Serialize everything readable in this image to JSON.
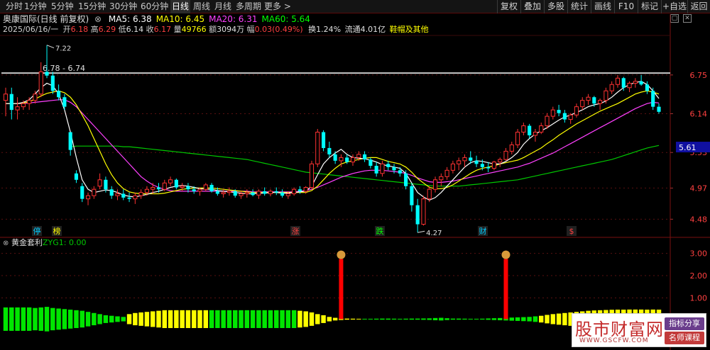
{
  "toolbar": {
    "periods": [
      "分时",
      "1分钟",
      "5分钟",
      "15分钟",
      "30分钟",
      "60分钟",
      "日线",
      "周线",
      "月线",
      "多周期",
      "更多 >"
    ],
    "active": "日线",
    "right": [
      "复权",
      "叠加",
      "多股",
      "统计",
      "画线",
      "F10",
      "标记",
      "+自选",
      "返回"
    ]
  },
  "header": {
    "title": "奥康国际(日线 前复权)",
    "ma": [
      {
        "label": "MA5: 6.38",
        "color": "#ffffff"
      },
      {
        "label": "MA10: 6.45",
        "color": "#ffff00"
      },
      {
        "label": "MA20: 6.31",
        "color": "#ff40ff"
      },
      {
        "label": "MA60: 5.64",
        "color": "#00ff00"
      }
    ],
    "date": "2025/06/16/一",
    "open_label": "开",
    "open": "6.18",
    "high_label": "高",
    "high": "6.29",
    "low_label": "低",
    "low": "6.14",
    "close_label": "收",
    "close": "6.17",
    "vol_label": "量",
    "vol": "49766",
    "amt_label": "额",
    "amt": "3094万",
    "chg_label": "幅",
    "chg": "0.03(0.49%)",
    "turnover": "换1.24%",
    "float": "流通4.01亿",
    "industry": "鞋帽及其他"
  },
  "indicator": {
    "title": "黄金套利",
    "value": "ZYG1: 0.00",
    "y_ticks": [
      "3.00",
      "2.00",
      "1.00"
    ]
  },
  "annotations": {
    "hline": "6.78 - 6.74",
    "high_mark": "7.22",
    "low_mark": "4.27",
    "price_tag": "5.61",
    "events": [
      "停",
      "榜",
      "涨",
      "跌",
      "财",
      "$"
    ]
  },
  "watermark": {
    "name": "股市财富网",
    "url": "WWW.GSCFW.COM",
    "tag1": "指标分享",
    "tag2": "名师课程"
  },
  "colors": {
    "up": "#ff3232",
    "down": "#00ffff",
    "ma5": "#ffffff",
    "ma10": "#ffff00",
    "ma20": "#ff40ff",
    "ma60": "#00c800",
    "bar_green": "#00e600",
    "bar_yellow": "#ffff00",
    "signal": "#ff0000"
  },
  "chart_data": {
    "type": "candlestick",
    "y_ticks": [
      6.75,
      6.14,
      5.53,
      4.97,
      4.48
    ],
    "ylim": [
      4.25,
      7.35
    ],
    "candles": [
      [
        6.35,
        6.55,
        6.1,
        6.45
      ],
      [
        6.45,
        6.55,
        6.05,
        6.2
      ],
      [
        6.2,
        6.4,
        6.05,
        6.25
      ],
      [
        6.25,
        6.35,
        6.2,
        6.3
      ],
      [
        6.3,
        6.4,
        6.2,
        6.35
      ],
      [
        6.35,
        6.5,
        6.3,
        6.45
      ],
      [
        6.45,
        6.95,
        6.4,
        6.8
      ],
      [
        6.8,
        7.22,
        6.7,
        6.74
      ],
      [
        6.74,
        6.8,
        6.45,
        6.5
      ],
      [
        6.5,
        6.6,
        6.35,
        6.4
      ],
      [
        6.4,
        6.45,
        6.2,
        6.25
      ],
      [
        5.85,
        5.6,
        5.48,
        5.57
      ],
      [
        5.2,
        5.25,
        5.05,
        5.1
      ],
      [
        5.0,
        5.05,
        4.75,
        4.8
      ],
      [
        4.8,
        4.9,
        4.7,
        4.85
      ],
      [
        4.85,
        5.0,
        4.8,
        4.95
      ],
      [
        5.0,
        5.2,
        4.95,
        5.1
      ],
      [
        5.1,
        5.15,
        4.9,
        4.95
      ],
      [
        4.95,
        5.0,
        4.8,
        4.85
      ],
      [
        4.85,
        4.95,
        4.78,
        4.88
      ],
      [
        4.88,
        4.95,
        4.78,
        4.82
      ],
      [
        4.82,
        4.9,
        4.75,
        4.8
      ],
      [
        4.8,
        4.9,
        4.72,
        4.85
      ],
      [
        4.85,
        4.95,
        4.8,
        4.9
      ],
      [
        4.9,
        5.0,
        4.85,
        4.95
      ],
      [
        4.95,
        5.05,
        4.88,
        4.98
      ],
      [
        4.98,
        5.05,
        4.9,
        4.95
      ],
      [
        4.95,
        5.1,
        4.92,
        5.05
      ],
      [
        5.05,
        5.15,
        5.0,
        5.1
      ],
      [
        5.1,
        5.12,
        4.95,
        4.98
      ],
      [
        4.98,
        5.05,
        4.92,
        5.0
      ],
      [
        5.0,
        5.05,
        4.9,
        4.95
      ],
      [
        4.95,
        5.0,
        4.88,
        4.92
      ],
      [
        4.92,
        4.98,
        4.85,
        4.95
      ],
      [
        4.95,
        5.05,
        4.92,
        5.02
      ],
      [
        5.02,
        5.05,
        4.9,
        4.92
      ],
      [
        4.92,
        4.98,
        4.85,
        4.88
      ],
      [
        4.88,
        4.95,
        4.82,
        4.9
      ],
      [
        4.9,
        4.98,
        4.85,
        4.92
      ],
      [
        4.92,
        4.95,
        4.82,
        4.85
      ],
      [
        4.85,
        4.92,
        4.8,
        4.88
      ],
      [
        4.88,
        4.95,
        4.82,
        4.9
      ],
      [
        4.9,
        4.95,
        4.84,
        4.86
      ],
      [
        4.86,
        4.95,
        4.8,
        4.92
      ],
      [
        4.92,
        4.98,
        4.85,
        4.88
      ],
      [
        4.88,
        4.95,
        4.84,
        4.92
      ],
      [
        4.92,
        4.98,
        4.86,
        4.9
      ],
      [
        4.9,
        4.95,
        4.82,
        4.85
      ],
      [
        4.85,
        4.92,
        4.8,
        4.88
      ],
      [
        4.88,
        4.98,
        4.85,
        4.95
      ],
      [
        4.95,
        5.0,
        4.88,
        4.92
      ],
      [
        4.92,
        5.0,
        4.88,
        4.98
      ],
      [
        4.98,
        5.4,
        4.95,
        5.35
      ],
      [
        5.35,
        5.9,
        5.3,
        5.85
      ],
      [
        5.85,
        5.88,
        5.55,
        5.6
      ],
      [
        5.6,
        5.7,
        5.45,
        5.5
      ],
      [
        5.5,
        5.55,
        5.35,
        5.4
      ],
      [
        5.4,
        5.5,
        5.3,
        5.45
      ],
      [
        5.45,
        5.5,
        5.35,
        5.38
      ],
      [
        5.38,
        5.5,
        5.32,
        5.45
      ],
      [
        5.45,
        5.55,
        5.4,
        5.5
      ],
      [
        5.5,
        5.55,
        5.38,
        5.42
      ],
      [
        5.42,
        5.45,
        5.28,
        5.32
      ],
      [
        5.32,
        5.38,
        5.15,
        5.2
      ],
      [
        5.2,
        5.4,
        5.15,
        5.35
      ],
      [
        5.35,
        5.4,
        5.25,
        5.3
      ],
      [
        5.3,
        5.35,
        5.2,
        5.25
      ],
      [
        5.25,
        5.3,
        5.15,
        5.2
      ],
      [
        5.2,
        5.25,
        4.95,
        5.0
      ],
      [
        5.0,
        5.05,
        4.6,
        4.7
      ],
      [
        4.7,
        4.8,
        4.27,
        4.4
      ],
      [
        4.4,
        4.85,
        4.38,
        4.8
      ],
      [
        4.8,
        5.0,
        4.75,
        4.95
      ],
      [
        4.95,
        5.15,
        4.9,
        5.1
      ],
      [
        5.1,
        5.2,
        5.0,
        5.15
      ],
      [
        5.15,
        5.3,
        5.1,
        5.25
      ],
      [
        5.25,
        5.4,
        5.2,
        5.35
      ],
      [
        5.35,
        5.45,
        5.25,
        5.4
      ],
      [
        5.4,
        5.5,
        5.3,
        5.45
      ],
      [
        5.45,
        5.55,
        5.35,
        5.4
      ],
      [
        5.4,
        5.48,
        5.3,
        5.35
      ],
      [
        5.35,
        5.42,
        5.25,
        5.3
      ],
      [
        5.3,
        5.38,
        5.22,
        5.28
      ],
      [
        5.28,
        5.4,
        5.25,
        5.38
      ],
      [
        5.38,
        5.45,
        5.3,
        5.42
      ],
      [
        5.42,
        5.6,
        5.4,
        5.55
      ],
      [
        5.55,
        5.7,
        5.5,
        5.65
      ],
      [
        5.65,
        5.9,
        5.6,
        5.85
      ],
      [
        5.85,
        6.0,
        5.8,
        5.95
      ],
      [
        5.95,
        5.98,
        5.75,
        5.8
      ],
      [
        5.8,
        5.9,
        5.7,
        5.85
      ],
      [
        5.85,
        6.0,
        5.82,
        5.95
      ],
      [
        5.95,
        6.15,
        5.9,
        6.1
      ],
      [
        6.1,
        6.25,
        6.05,
        6.2
      ],
      [
        6.2,
        6.28,
        6.1,
        6.15
      ],
      [
        6.15,
        6.2,
        6.0,
        6.05
      ],
      [
        6.05,
        6.15,
        5.98,
        6.12
      ],
      [
        6.12,
        6.3,
        6.08,
        6.25
      ],
      [
        6.25,
        6.4,
        6.2,
        6.35
      ],
      [
        6.35,
        6.45,
        6.28,
        6.4
      ],
      [
        6.4,
        6.42,
        6.25,
        6.3
      ],
      [
        6.3,
        6.38,
        6.2,
        6.35
      ],
      [
        6.35,
        6.55,
        6.3,
        6.5
      ],
      [
        6.5,
        6.65,
        6.45,
        6.6
      ],
      [
        6.6,
        6.75,
        6.55,
        6.7
      ],
      [
        6.7,
        6.72,
        6.5,
        6.55
      ],
      [
        6.55,
        6.65,
        6.48,
        6.62
      ],
      [
        6.62,
        6.7,
        6.55,
        6.65
      ],
      [
        6.65,
        6.75,
        6.58,
        6.6
      ],
      [
        6.6,
        6.65,
        6.45,
        6.5
      ],
      [
        6.5,
        6.55,
        6.2,
        6.25
      ],
      [
        6.25,
        6.3,
        6.14,
        6.17
      ]
    ],
    "ma5": [
      6.3,
      6.3,
      6.3,
      6.32,
      6.36,
      6.45,
      6.55,
      6.62,
      6.58,
      6.45,
      6.2,
      5.85,
      5.45,
      5.1,
      4.95,
      4.9,
      4.92,
      4.94,
      4.93,
      4.9,
      4.86,
      4.84,
      4.83,
      4.85,
      4.87,
      4.9,
      4.92,
      4.95,
      4.98,
      5.0,
      5.01,
      5.0,
      4.98,
      4.96,
      4.95,
      4.95,
      4.93,
      4.92,
      4.91,
      4.9,
      4.89,
      4.88,
      4.88,
      4.89,
      4.89,
      4.9,
      4.9,
      4.89,
      4.89,
      4.9,
      4.91,
      4.92,
      5.0,
      5.18,
      5.35,
      5.45,
      5.52,
      5.58,
      5.5,
      5.45,
      5.44,
      5.43,
      5.41,
      5.38,
      5.34,
      5.32,
      5.3,
      5.28,
      5.2,
      5.05,
      4.9,
      4.83,
      4.78,
      4.82,
      4.9,
      5.0,
      5.1,
      5.2,
      5.3,
      5.37,
      5.4,
      5.39,
      5.37,
      5.35,
      5.35,
      5.39,
      5.45,
      5.53,
      5.66,
      5.75,
      5.82,
      5.87,
      5.92,
      5.98,
      6.04,
      6.09,
      6.12,
      6.16,
      6.2,
      6.25,
      6.28,
      6.3,
      6.34,
      6.4,
      6.48,
      6.55,
      6.6,
      6.63,
      6.65,
      6.6,
      6.5,
      6.38
    ],
    "ma10": [
      6.3,
      6.3,
      6.3,
      6.31,
      6.33,
      6.37,
      6.42,
      6.46,
      6.48,
      6.5,
      6.47,
      6.4,
      6.28,
      6.12,
      5.95,
      5.75,
      5.55,
      5.35,
      5.18,
      5.05,
      4.96,
      4.91,
      4.89,
      4.88,
      4.88,
      4.88,
      4.88,
      4.89,
      4.91,
      4.93,
      4.95,
      4.96,
      4.97,
      4.97,
      4.97,
      4.97,
      4.96,
      4.95,
      4.94,
      4.93,
      4.92,
      4.91,
      4.9,
      4.9,
      4.9,
      4.9,
      4.9,
      4.9,
      4.9,
      4.9,
      4.9,
      4.9,
      4.93,
      5.0,
      5.1,
      5.2,
      5.28,
      5.35,
      5.38,
      5.4,
      5.42,
      5.44,
      5.45,
      5.45,
      5.42,
      5.39,
      5.37,
      5.35,
      5.3,
      5.22,
      5.12,
      5.05,
      4.98,
      4.96,
      4.96,
      4.98,
      5.02,
      5.08,
      5.14,
      5.2,
      5.25,
      5.28,
      5.3,
      5.32,
      5.35,
      5.37,
      5.39,
      5.41,
      5.45,
      5.5,
      5.55,
      5.6,
      5.67,
      5.73,
      5.8,
      5.86,
      5.92,
      5.98,
      6.03,
      6.08,
      6.13,
      6.18,
      6.22,
      6.26,
      6.3,
      6.35,
      6.4,
      6.45,
      6.48,
      6.5,
      6.48,
      6.45
    ],
    "ma20": [
      6.3,
      6.3,
      6.3,
      6.3,
      6.31,
      6.32,
      6.33,
      6.34,
      6.35,
      6.36,
      6.36,
      6.32,
      6.25,
      6.15,
      6.05,
      5.95,
      5.85,
      5.75,
      5.65,
      5.55,
      5.45,
      5.35,
      5.25,
      5.15,
      5.08,
      5.02,
      4.98,
      4.95,
      4.93,
      4.92,
      4.92,
      4.92,
      4.92,
      4.92,
      4.92,
      4.92,
      4.92,
      4.92,
      4.92,
      4.92,
      4.92,
      4.92,
      4.91,
      4.91,
      4.91,
      4.91,
      4.91,
      4.91,
      4.91,
      4.91,
      4.92,
      4.93,
      4.95,
      4.98,
      5.02,
      5.06,
      5.1,
      5.14,
      5.17,
      5.2,
      5.22,
      5.24,
      5.25,
      5.25,
      5.25,
      5.24,
      5.23,
      5.22,
      5.2,
      5.17,
      5.13,
      5.1,
      5.07,
      5.06,
      5.06,
      5.07,
      5.08,
      5.1,
      5.12,
      5.14,
      5.16,
      5.18,
      5.2,
      5.22,
      5.24,
      5.26,
      5.28,
      5.3,
      5.33,
      5.36,
      5.4,
      5.44,
      5.48,
      5.52,
      5.57,
      5.62,
      5.67,
      5.72,
      5.77,
      5.82,
      5.87,
      5.92,
      5.97,
      6.02,
      6.07,
      6.12,
      6.17,
      6.22,
      6.26,
      6.3,
      6.32,
      6.31
    ],
    "ma60": [
      null,
      null,
      null,
      null,
      null,
      null,
      null,
      null,
      null,
      null,
      null,
      5.62,
      5.63,
      5.63,
      5.63,
      5.63,
      5.63,
      5.63,
      5.63,
      5.63,
      5.62,
      5.62,
      5.61,
      5.6,
      5.59,
      5.58,
      5.57,
      5.56,
      5.55,
      5.54,
      5.53,
      5.52,
      5.51,
      5.5,
      5.49,
      5.48,
      5.47,
      5.46,
      5.45,
      5.44,
      5.43,
      5.42,
      5.4,
      5.38,
      5.36,
      5.34,
      5.32,
      5.3,
      5.28,
      5.26,
      5.24,
      5.22,
      5.21,
      5.2,
      5.19,
      5.18,
      5.17,
      5.16,
      5.15,
      5.14,
      5.13,
      5.12,
      5.11,
      5.1,
      5.09,
      5.08,
      5.07,
      5.06,
      5.05,
      5.04,
      5.03,
      5.02,
      5.01,
      5.0,
      5.0,
      5.0,
      5.0,
      5.0,
      5.01,
      5.02,
      5.03,
      5.04,
      5.05,
      5.06,
      5.07,
      5.08,
      5.09,
      5.1,
      5.12,
      5.14,
      5.16,
      5.18,
      5.2,
      5.22,
      5.24,
      5.26,
      5.28,
      5.3,
      5.32,
      5.34,
      5.36,
      5.38,
      5.4,
      5.42,
      5.45,
      5.48,
      5.51,
      5.54,
      5.57,
      5.6,
      5.62,
      5.64
    ],
    "indicator_bars": [
      1.05,
      1.05,
      1.05,
      1.05,
      1.05,
      1.0,
      1.05,
      1.1,
      1.0,
      0.95,
      0.9,
      0.85,
      0.8,
      0.75,
      0.65,
      0.55,
      0.45,
      0.35,
      0.3,
      0.25,
      0.2,
      0.45,
      0.55,
      0.6,
      0.65,
      0.7,
      0.75,
      0.8,
      0.8,
      0.8,
      0.8,
      0.8,
      0.8,
      0.8,
      0.8,
      0.8,
      0.8,
      0.8,
      0.8,
      0.8,
      0.8,
      0.8,
      0.8,
      0.8,
      0.8,
      0.8,
      0.8,
      0.8,
      0.8,
      0.8,
      0.75,
      0.7,
      0.6,
      0.45,
      0.35,
      0.2,
      0.12,
      0.08,
      0.05,
      0.04,
      0.03,
      0.02,
      0.03,
      0.04,
      0.05,
      0.05,
      0.04,
      0.03,
      0.04,
      0.05,
      0.05,
      0.06,
      0.07,
      0.1,
      0.12,
      0.08,
      0.05,
      0.05,
      0.04,
      0.03,
      0.02,
      0.04,
      0.06,
      0.08,
      0.1,
      0.12,
      0.14,
      0.16,
      0.18,
      0.2,
      0.25,
      0.3,
      0.38,
      0.45,
      0.5,
      0.55,
      0.6,
      0.65,
      0.7,
      0.75,
      0.78,
      0.8,
      0.82,
      0.84,
      0.85,
      0.85,
      0.86,
      0.86,
      0.86,
      0.85,
      0.86,
      0.85
    ],
    "indicator_colors": "GGGGGGGGGGGGGGGGGGGGGYYYYYYYYYYYYYYGGGGGGGGGGGGGGGYYYYYYYYYYYGGGGGGGGGGGGGGGGGGGGGGGGGGGGGGYYYYYYYYYYYYYYYYYYYYYYYYYYYYGGG",
    "signals": [
      {
        "index": 57,
        "value": 3.0
      },
      {
        "index": 85,
        "value": 3.0
      }
    ],
    "indicator_ylim": [
      0,
      3.4
    ]
  }
}
